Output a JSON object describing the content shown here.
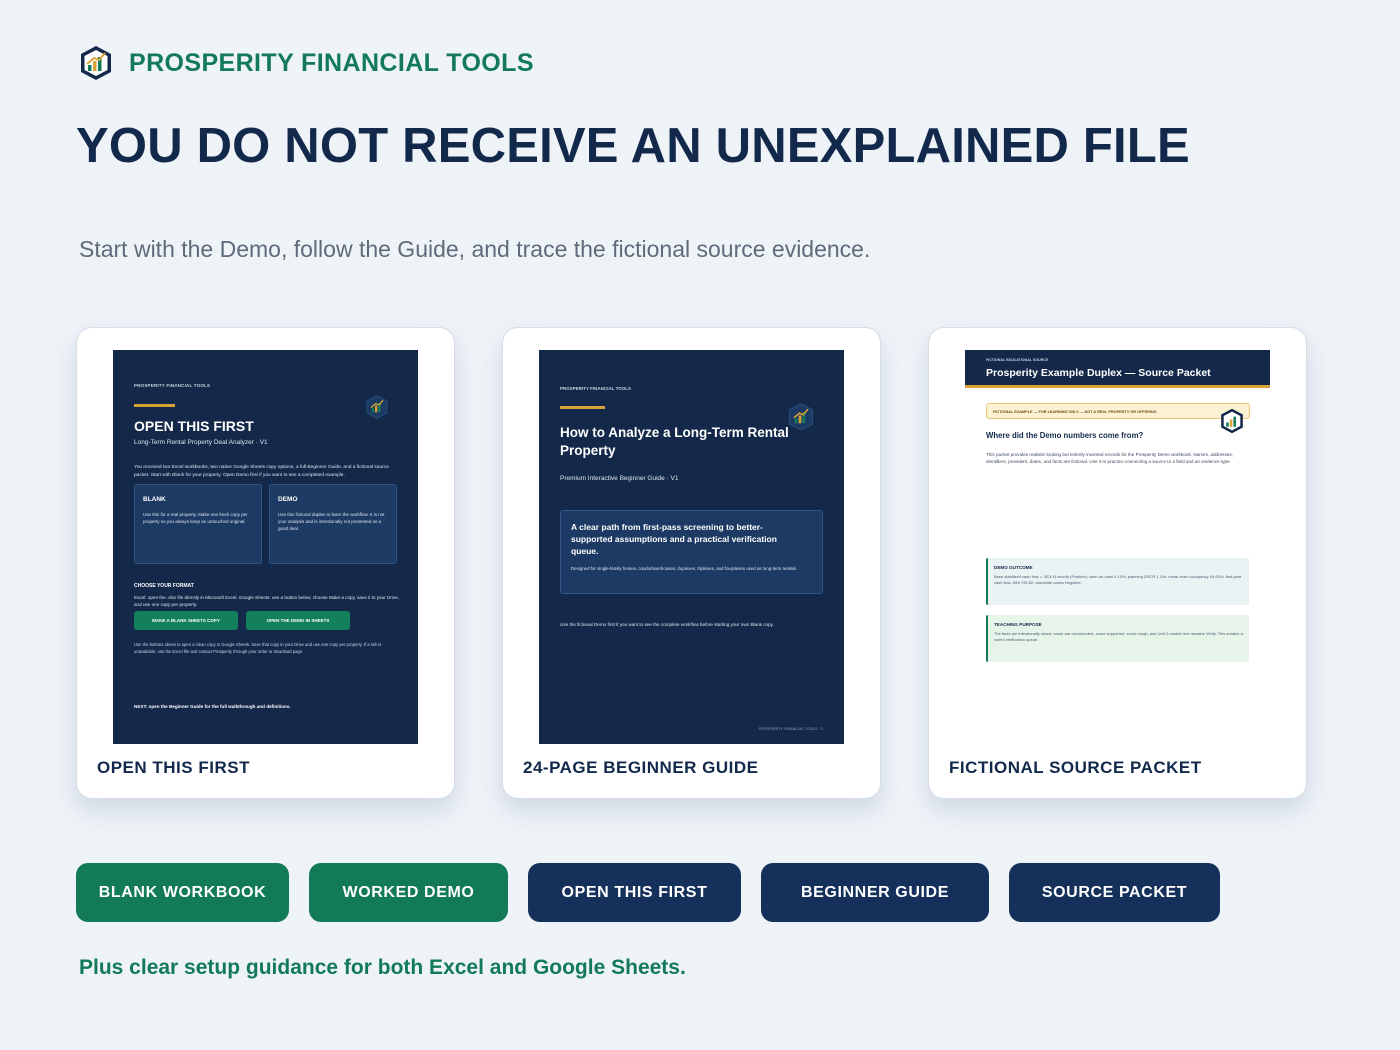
{
  "brand": {
    "name": "PROSPERITY FINANCIAL TOOLS",
    "logo_icon": "hexagon-chart-icon"
  },
  "headline": "YOU DO NOT RECEIVE AN UNEXPLAINED FILE",
  "subhead": "Start with the Demo, follow the Guide, and trace the fictional source evidence.",
  "colors": {
    "green": "#137a57",
    "navy": "#14294a",
    "gold": "#d8a235"
  },
  "cards": [
    {
      "caption": "OPEN THIS FIRST",
      "doc": {
        "brand": "PROSPERITY FINANCIAL TOOLS",
        "title": "OPEN THIS FIRST",
        "subtitle": "Long-Term Rental Property Deal Analyzer · V1",
        "intro": "You received two Excel workbooks, two native Google Sheets copy options, a full Beginner Guide, and a fictional source packet. Start with Blank for your property. Open Demo first if you want to see a completed example.",
        "blank_title": "BLANK",
        "blank_text": "Use this for a real property. Make one fresh copy per property so you always keep an untouched original.",
        "demo_title": "DEMO",
        "demo_text": "Use this fictional duplex to learn the workflow. It is not your analysis and is intentionally not presented as a good deal.",
        "format_title": "CHOOSE YOUR FORMAT",
        "format_text": "Excel: open the .xlsx file directly in Microsoft Excel. Google Sheets: use a button below, choose Make a copy, save it to your Drive, and use one copy per property.",
        "btn_blank": "MAKE A BLANK SHEETS COPY",
        "btn_demo": "OPEN THE DEMO IN SHEETS",
        "note": "Use the buttons above to open a clean copy in Google Sheets. Save that copy to your Drive and use one copy per property. If a link is unavailable, use the Excel file and contact Prosperity through your order or download page.",
        "next": "NEXT: open the Beginner Guide for the full walkthrough and definitions."
      }
    },
    {
      "caption": "24-PAGE BEGINNER GUIDE",
      "doc": {
        "brand": "PROSPERITY FINANCIAL TOOLS",
        "title": "How to Analyze a Long-Term Rental Property",
        "subtitle": "Premium Interactive Beginner Guide · V1",
        "box_title": "A clear path from first-pass screening to better-supported assumptions and a practical verification queue.",
        "box_text": "Designed for single-family homes, condo/townhouses, duplexes, triplexes, and fourplexes used as long-term rentals.",
        "note": "Use the fictional Demo first if you want to see the complete workflow before starting your own Blank copy.",
        "footer": "PROSPERITY FINANCIAL TOOLS · 1"
      }
    },
    {
      "caption": "FICTIONAL SOURCE PACKET",
      "doc": {
        "kicker": "FICTIONAL EDUCATIONAL SOURCE",
        "title": "Prosperity Example Duplex — Source Packet",
        "warning": "FICTIONAL EXAMPLE — FOR LEARNING ONLY — NOT A REAL PROPERTY OR OFFERING",
        "question": "Where did the Demo numbers come from?",
        "text": "This packet provides realistic-looking but entirely invented records for the Prosperity Demo workbook. Names, addresses, identifiers, providers, dates, and facts are fictional. Use it to practice connecting a source to a field and an evidence type.",
        "outcome_title": "DEMO OUTCOME",
        "outcome_text": "Base stabilized cash flow = -$13.41/month (Positive); cash-on-cash 0.10%; planning DSCR 1.10x; break-even occupancy 94.62%; first-year cash flow -$49,795.82; downside cases Negative.",
        "purpose_title": "TEACHING PURPOSE",
        "purpose_text": "The facts are intentionally mixed: some are documented, some supported, some rough, and Unit 2 market rent remains Verify. This creates a useful verification queue."
      }
    }
  ],
  "buttons": [
    "BLANK WORKBOOK",
    "WORKED DEMO",
    "OPEN THIS FIRST",
    "BEGINNER GUIDE",
    "SOURCE PACKET"
  ],
  "footer_note": "Plus clear setup guidance for both Excel and Google Sheets."
}
